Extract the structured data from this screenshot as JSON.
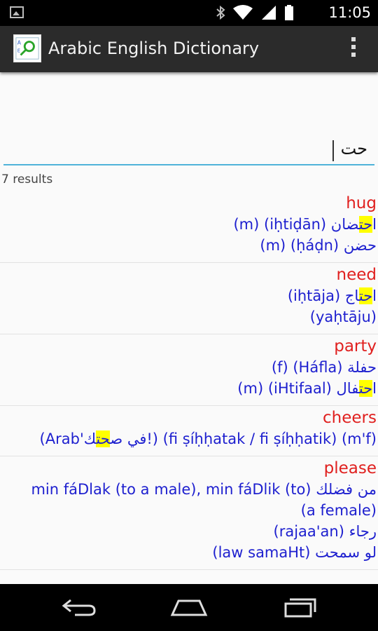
{
  "status_bar": {
    "time": "11:05",
    "icons": [
      "gallery-icon",
      "bluetooth-icon",
      "wifi-icon",
      "signal-icon",
      "battery-icon"
    ]
  },
  "app_bar": {
    "title": "Arabic English Dictionary"
  },
  "search": {
    "query": "حت"
  },
  "results_count": "7 results",
  "entries": [
    {
      "word": "hug",
      "lines": [
        [
          "(m) (iḥtiḍān) ا",
          "حت",
          "ضان"
        ],
        [
          "(m) (ḥáḍn) حضن"
        ]
      ]
    },
    {
      "word": "need",
      "lines": [
        [
          "(iḥtāja) ا",
          "حت",
          "اج"
        ],
        [
          "(yaḥtāju)"
        ]
      ]
    },
    {
      "word": "party",
      "lines": [
        [
          "(f) (Háfla) حفلة"
        ],
        [
          "(m) (iHtifaal) ا",
          "حت",
          "فال"
        ]
      ]
    },
    {
      "word": "cheers",
      "lines": [
        [
          "(Arab'في ص",
          "حت",
          "ك!) (fi ṣíḥḥatak / fi ṣíḥḥatik) (m'f)"
        ]
      ]
    },
    {
      "word": "please",
      "lines": [
        [
          "min fáDlak (to a male), min fáDlik (to) من فضلك"
        ],
        [
          "(a female)"
        ],
        [
          "(rajaa'an) رجاء"
        ],
        [
          "(law samaHt) لو سمحت"
        ]
      ]
    }
  ]
}
